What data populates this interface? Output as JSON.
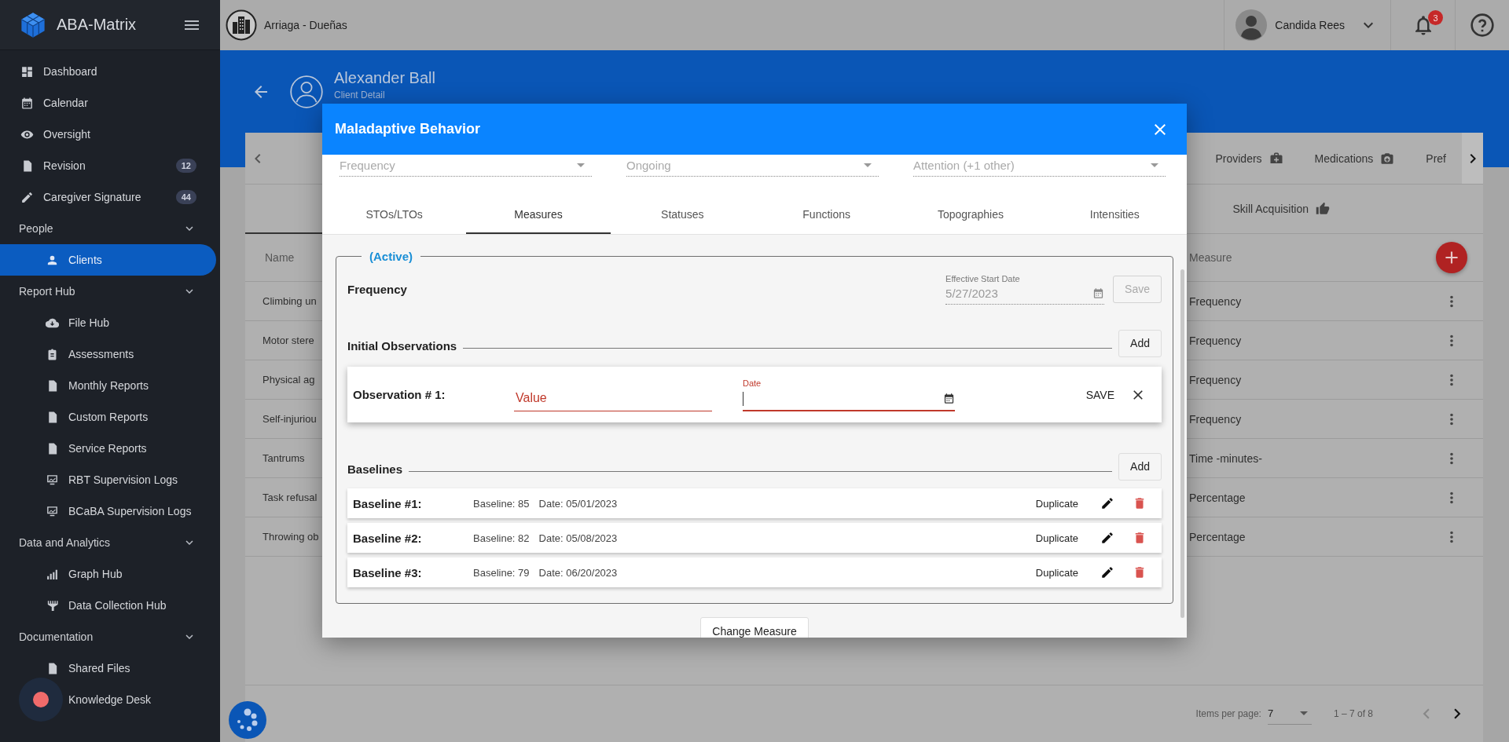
{
  "sidebar": {
    "brand": "ABA-Matrix",
    "items": [
      {
        "kind": "link",
        "label": "Dashboard",
        "selected": false
      },
      {
        "kind": "link",
        "label": "Calendar",
        "selected": false
      },
      {
        "kind": "link",
        "label": "Oversight",
        "selected": false
      },
      {
        "kind": "link",
        "label": "Revision",
        "badge": "12",
        "selected": false
      },
      {
        "kind": "link",
        "label": "Caregiver Signature",
        "badge": "44",
        "selected": false
      },
      {
        "kind": "section",
        "label": "People",
        "expanded": true,
        "children": [
          {
            "label": "Clients",
            "selected": true
          }
        ]
      },
      {
        "kind": "section",
        "label": "Report Hub",
        "expanded": true,
        "children": [
          {
            "label": "File Hub",
            "selected": false
          },
          {
            "label": "Assessments",
            "selected": false
          },
          {
            "label": "Monthly Reports",
            "selected": false
          },
          {
            "label": "Custom Reports",
            "selected": false
          },
          {
            "label": "Service Reports",
            "selected": false
          },
          {
            "label": "RBT Supervision Logs",
            "selected": false
          },
          {
            "label": "BCaBA Supervision Logs",
            "selected": false
          }
        ]
      },
      {
        "kind": "section",
        "label": "Data and Analytics",
        "expanded": true,
        "children": [
          {
            "label": "Graph Hub",
            "selected": false
          },
          {
            "label": "Data Collection Hub",
            "selected": false
          }
        ]
      },
      {
        "kind": "section",
        "label": "Documentation",
        "expanded": true,
        "children": [
          {
            "label": "Shared Files",
            "selected": false
          },
          {
            "label": "Knowledge Desk",
            "selected": false
          }
        ]
      }
    ]
  },
  "topbar": {
    "company": "Arriaga - Dueñas",
    "user": "Candida Rees",
    "notifications": "3"
  },
  "client_header": {
    "name": "Alexander Ball",
    "subtitle": "Client Detail"
  },
  "detail_tabs": [
    {
      "label": "Providers"
    },
    {
      "label": "Medications"
    },
    {
      "label": "Pref"
    }
  ],
  "section_tabs": [
    {
      "label": "Skill Acquisition"
    }
  ],
  "table": {
    "columns": [
      "Name",
      "Measure"
    ],
    "rows": [
      {
        "name": "Climbing un",
        "measure": "Frequency"
      },
      {
        "name": "Motor stere",
        "measure": "Frequency"
      },
      {
        "name": "Physical ag",
        "measure": "Frequency"
      },
      {
        "name": "Self-injuriou",
        "measure": "Frequency"
      },
      {
        "name": "Tantrums",
        "measure": "Time -minutes-"
      },
      {
        "name": "Task refusal",
        "measure": "Percentage"
      },
      {
        "name": "Throwing ob",
        "measure": "Percentage"
      }
    ]
  },
  "paginator": {
    "label": "Items per page:",
    "page_size": "7",
    "range": "1 – 7 of 8"
  },
  "modal": {
    "title": "Maladaptive Behavior",
    "top_fields": [
      {
        "value": "Frequency",
        "disabled": true
      },
      {
        "value": "Ongoing",
        "disabled": true
      },
      {
        "value": "Attention (+1 other)",
        "disabled": true
      }
    ],
    "tabs": [
      {
        "label": "STOs/LTOs",
        "selected": false
      },
      {
        "label": "Measures",
        "selected": true
      },
      {
        "label": "Statuses",
        "selected": false
      },
      {
        "label": "Functions",
        "selected": false
      },
      {
        "label": "Topographies",
        "selected": false
      },
      {
        "label": "Intensities",
        "selected": false
      }
    ],
    "status": "(Active)",
    "measure": "Frequency",
    "start_date": {
      "label": "Effective Start Date",
      "value": "5/27/2023",
      "disabled": true
    },
    "save_button": {
      "label": "Save",
      "disabled": true
    },
    "initial_observations": {
      "title": "Initial Observations",
      "add_button": "Add",
      "items": [
        {
          "label": "Observation # 1:",
          "value_placeholder": "Value",
          "date_label": "Date",
          "invalid": true,
          "save": "SAVE"
        }
      ]
    },
    "baselines": {
      "title": "Baselines",
      "add_button": "Add",
      "items": [
        {
          "label": "Baseline #1:",
          "baseline": "Baseline: 85",
          "date": "Date: 05/01/2023",
          "action": "Duplicate"
        },
        {
          "label": "Baseline #2:",
          "baseline": "Baseline: 82",
          "date": "Date: 05/08/2023",
          "action": "Duplicate"
        },
        {
          "label": "Baseline #3:",
          "baseline": "Baseline: 79",
          "date": "Date: 06/20/2023",
          "action": "Duplicate"
        }
      ]
    },
    "change_button": "Change Measure"
  }
}
